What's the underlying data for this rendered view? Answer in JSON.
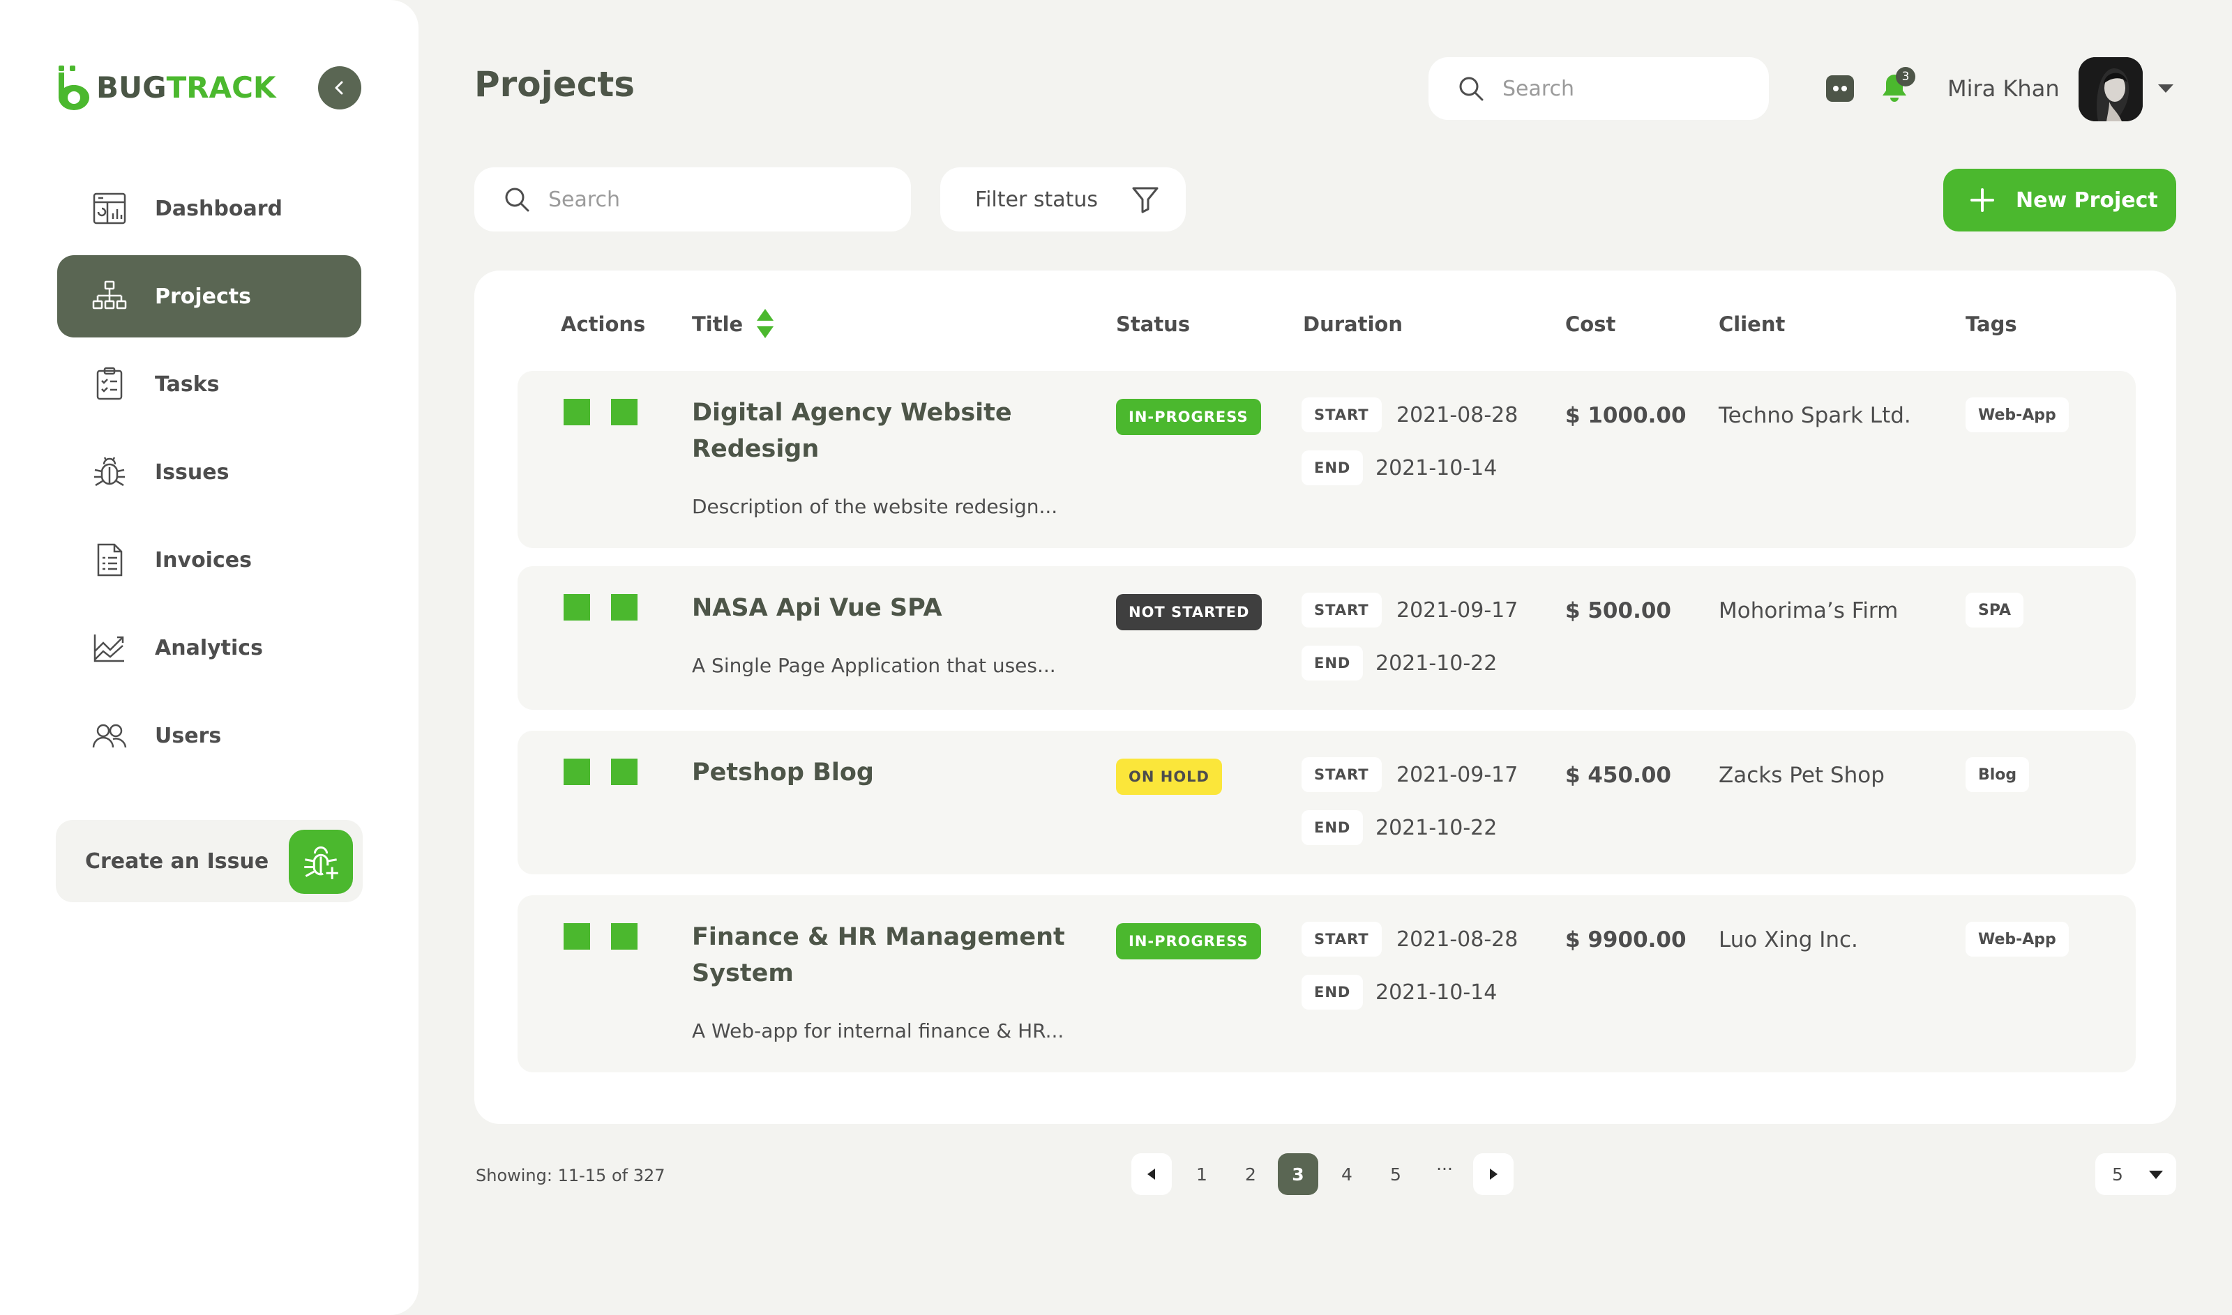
{
  "app": {
    "logo_part1": "BUG",
    "logo_part2": "TRACK",
    "brand_color": "#4bb82e",
    "sidebar_active_color": "#5a6653"
  },
  "sidebar": {
    "items": [
      {
        "label": "Dashboard",
        "icon": "dashboard-icon"
      },
      {
        "label": "Projects",
        "icon": "projects-icon",
        "active": true
      },
      {
        "label": "Tasks",
        "icon": "tasks-icon"
      },
      {
        "label": "Issues",
        "icon": "bug-icon"
      },
      {
        "label": "Invoices",
        "icon": "invoice-icon"
      },
      {
        "label": "Analytics",
        "icon": "analytics-icon"
      },
      {
        "label": "Users",
        "icon": "users-icon"
      }
    ],
    "create_issue_label": "Create an Issue"
  },
  "header": {
    "title": "Projects",
    "search_placeholder": "Search",
    "notification_count": "3",
    "user_name": "Mira Khan"
  },
  "toolbar": {
    "search_placeholder": "Search",
    "filter_label": "Filter status",
    "new_project_label": "New Project"
  },
  "table": {
    "columns": [
      "Actions",
      "Title",
      "Status",
      "Duration",
      "Cost",
      "Client",
      "Tags"
    ],
    "start_label": "START",
    "end_label": "END",
    "rows": [
      {
        "title": "Digital Agency Website Redesign",
        "description": "Description of the website redesign...",
        "status": "IN-PROGRESS",
        "start": "2021-08-28",
        "end": "2021-10-14",
        "cost": "$ 1000.00",
        "client": "Techno Spark Ltd.",
        "tag": "Web-App"
      },
      {
        "title": "NASA Api Vue SPA",
        "description": "A Single Page Application that uses...",
        "status": "NOT STARTED",
        "start": "2021-09-17",
        "end": "2021-10-22",
        "cost": "$ 500.00",
        "client": "Mohorima’s Firm",
        "tag": "SPA"
      },
      {
        "title": "Petshop Blog",
        "description": "",
        "status": "ON HOLD",
        "start": "2021-09-17",
        "end": "2021-10-22",
        "cost": "$ 450.00",
        "client": "Zacks Pet Shop",
        "tag": "Blog"
      },
      {
        "title": "Finance & HR Management System",
        "description": "A Web-app for internal finance & HR...",
        "status": "IN-PROGRESS",
        "start": "2021-08-28",
        "end": "2021-10-14",
        "cost": "$ 9900.00",
        "client": "Luo Xing Inc.",
        "tag": "Web-App"
      }
    ]
  },
  "pagination": {
    "showing": "Showing: 11-15 of 327",
    "pages": [
      "1",
      "2",
      "3",
      "4",
      "5"
    ],
    "current_page": "3",
    "ellipsis": "···",
    "per_page": "5"
  }
}
